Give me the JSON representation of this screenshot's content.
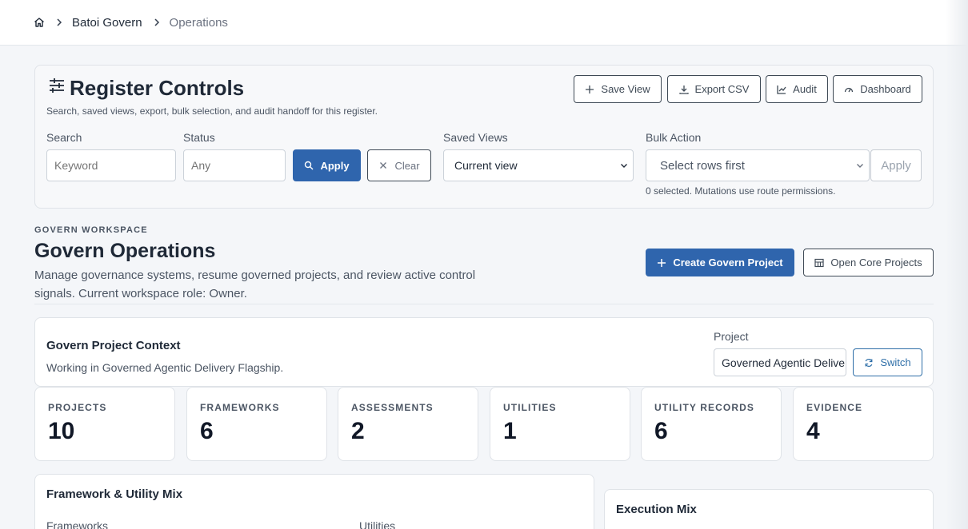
{
  "breadcrumb": {
    "home_icon": "home-icon",
    "workspace": "Batoi Govern",
    "current": "Operations"
  },
  "register": {
    "title": "Register Controls",
    "subtitle": "Search, saved views, export, bulk selection, and audit handoff for this register.",
    "actions": {
      "save_view": "Save View",
      "export_csv": "Export CSV",
      "audit": "Audit",
      "dashboard": "Dashboard"
    },
    "search": {
      "label": "Search",
      "placeholder": "Keyword"
    },
    "status": {
      "label": "Status",
      "placeholder": "Any"
    },
    "apply_label": "Apply",
    "clear_label": "Clear",
    "saved_views": {
      "label": "Saved Views",
      "value": "Current view"
    },
    "bulk": {
      "label": "Bulk Action",
      "value": "Select rows first",
      "apply_label": "Apply",
      "hint": "0 selected. Mutations use route permissions."
    }
  },
  "workspace": {
    "eyebrow": "GOVERN WORKSPACE",
    "title": "Govern Operations",
    "description": "Manage governance systems, resume governed projects, and review active control signals. Current workspace role: Owner.",
    "create_label": "Create Govern Project",
    "open_core_label": "Open Core Projects"
  },
  "context": {
    "title": "Govern Project Context",
    "description": "Working in Governed Agentic Delivery Flagship.",
    "project_label": "Project",
    "project_value": "Governed Agentic Delivery Flagship",
    "switch_label": "Switch"
  },
  "stats": [
    {
      "label": "PROJECTS",
      "value": "10"
    },
    {
      "label": "FRAMEWORKS",
      "value": "6"
    },
    {
      "label": "ASSESSMENTS",
      "value": "2"
    },
    {
      "label": "UTILITIES",
      "value": "1"
    },
    {
      "label": "UTILITY RECORDS",
      "value": "6"
    },
    {
      "label": "EVIDENCE",
      "value": "4"
    }
  ],
  "mix": {
    "title": "Framework & Utility Mix",
    "frameworks_label": "Frameworks",
    "utilities_label": "Utilities"
  },
  "execution": {
    "title": "Execution Mix"
  },
  "colors": {
    "primary": "#2f65ad",
    "accent_outline": "#2f6fa8"
  }
}
